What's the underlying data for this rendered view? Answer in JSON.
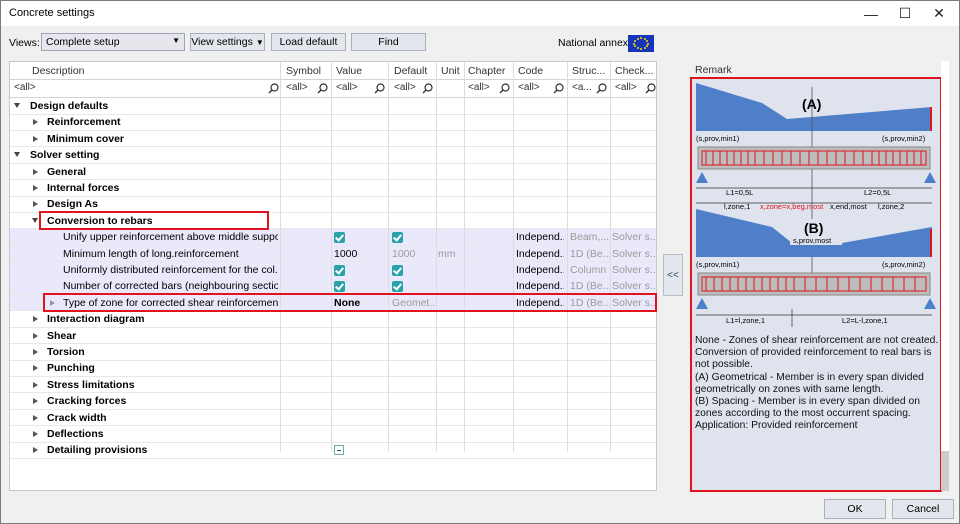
{
  "window": {
    "title": "Concrete settings"
  },
  "toolbar": {
    "views_label": "Views:",
    "views_value": "Complete setup",
    "view_settings": "View settings",
    "load_default": "Load default",
    "find": "Find",
    "national_annex": "National annex:"
  },
  "columns": [
    "Description",
    "Symbol",
    "Value",
    "Default",
    "Unit",
    "Chapter",
    "Code",
    "Struc...",
    "Check..."
  ],
  "filters": {
    "description": "<all>",
    "symbol": "<all>",
    "value": "<all>",
    "default": "<all>",
    "chapter": "<all>",
    "code": "<all>",
    "struc": "<a...",
    "check": "<all>"
  },
  "rows": [
    {
      "label": "Design defaults",
      "level": 0,
      "open": true,
      "bold": true
    },
    {
      "label": "Reinforcement",
      "level": 1,
      "bold": true
    },
    {
      "label": "Minimum cover",
      "level": 1,
      "bold": true
    },
    {
      "label": "Solver setting",
      "level": 0,
      "open": true,
      "bold": true
    },
    {
      "label": "General",
      "level": 1,
      "bold": true
    },
    {
      "label": "Internal forces",
      "level": 1,
      "bold": true
    },
    {
      "label": "Design As",
      "level": 1,
      "bold": true
    },
    {
      "label": "Conversion to rebars",
      "level": 1,
      "open": true,
      "bold": true
    },
    {
      "label": "Unify upper reinforcement above middle support",
      "level": 2,
      "value": "check",
      "default": "check",
      "code": "Independ...",
      "struc": "Beam,...",
      "check": "Solver s..."
    },
    {
      "label": "Minimum length of long.reinforcement",
      "level": 2,
      "value": "1000",
      "default": "1000",
      "unit": "mm",
      "code": "Independ...",
      "struc": "1D (Be...",
      "check": "Solver s..."
    },
    {
      "label": "Uniformly distributed reinforcement for the col...",
      "level": 2,
      "value": "check",
      "default": "check",
      "code": "Independ...",
      "struc": "Column",
      "check": "Solver s..."
    },
    {
      "label": "Number of corrected bars (neighbouring sectio...",
      "level": 2,
      "value": "check",
      "default": "check",
      "code": "Independ...",
      "struc": "1D (Be...",
      "check": "Solver s..."
    },
    {
      "label": "Type of zone for corrected shear reinforcement",
      "level": 2,
      "value": "None",
      "default": "Geomet...",
      "code": "Independ...",
      "struc": "1D (Be...",
      "check": "Solver s...",
      "current": true
    },
    {
      "label": "Interaction diagram",
      "level": 1,
      "bold": true
    },
    {
      "label": "Shear",
      "level": 1,
      "bold": true
    },
    {
      "label": "Torsion",
      "level": 1,
      "bold": true
    },
    {
      "label": "Punching",
      "level": 1,
      "bold": true
    },
    {
      "label": "Stress limitations",
      "level": 1,
      "bold": true
    },
    {
      "label": "Cracking forces",
      "level": 1,
      "bold": true
    },
    {
      "label": "Crack width",
      "level": 1,
      "bold": true
    },
    {
      "label": "Deflections",
      "level": 1,
      "bold": true
    },
    {
      "label": "Detailing provisions",
      "level": 1,
      "bold": true,
      "value": "minus"
    }
  ],
  "remark": {
    "title": "Remark",
    "diagram": {
      "label_a": "(A)",
      "label_b": "(B)",
      "s_prov_min1": "(s,prov,min1)",
      "s_prov_min2": "(s,prov,min2)",
      "s_prov_most": "s,prov,most",
      "l1_a": "L1=0,5L",
      "l2_a": "L2=0,5L",
      "l_zone1": "l,zone,1",
      "x_zone": "x,zone=x,beg,most",
      "x_end": "x,end,most",
      "l_zone2": "l,zone,2",
      "l1_b": "L1=l,zone,1",
      "l2_b": "L2=L-l,zone,1"
    },
    "text": [
      "None - Zones of shear reinforcement are not created. Conversion of provided reinforcement to real bars is not possible.",
      "(A) Geometrical - Member is in every span divided geometrically on zones with same length.",
      "(B) Spacing - Member is in every span divided on zones according to the most occurrent spacing.",
      "Application: Provided reinforcement"
    ]
  },
  "collapse_label": "<<",
  "footer": {
    "ok": "OK",
    "cancel": "Cancel"
  },
  "colors": {
    "accent": "#e0141e",
    "check": "#2aa3a8",
    "diagram_fill": "#4f7fc8"
  }
}
